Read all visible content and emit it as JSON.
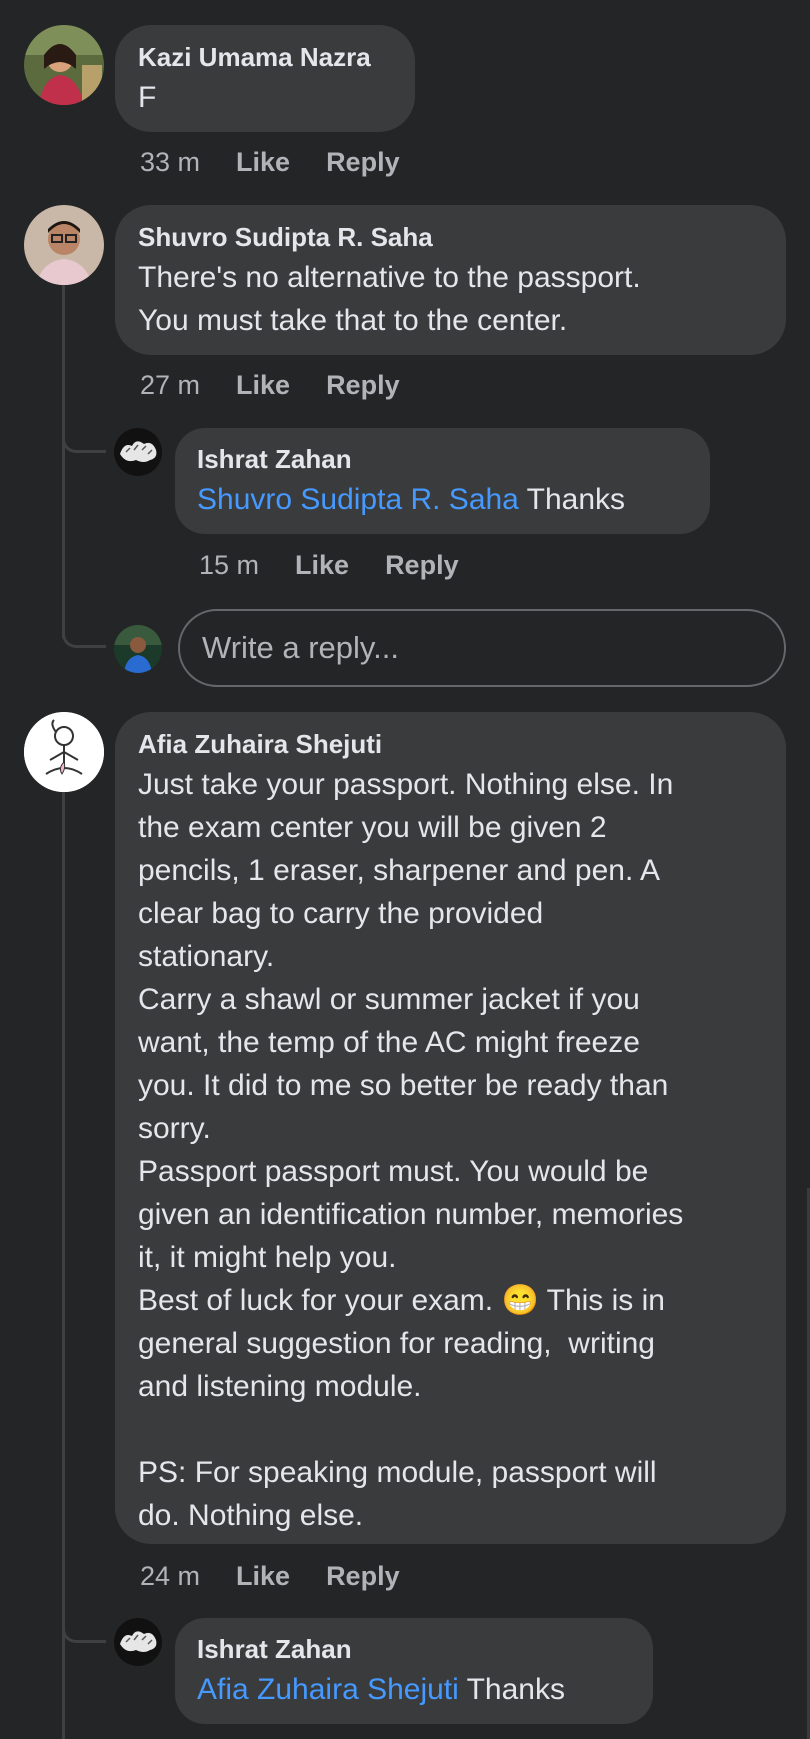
{
  "comments": [
    {
      "author": "Kazi Umama Nazra",
      "text": "F",
      "time": "33 m",
      "like": "Like",
      "reply": "Reply",
      "avatar": "profile-photo-woman"
    },
    {
      "author": "Shuvro Sudipta R. Saha",
      "text": "There's no alternative to the passport.\nYou must take that to the center.",
      "time": "27 m",
      "like": "Like",
      "reply": "Reply",
      "avatar": "profile-photo-man-glasses",
      "replies": [
        {
          "author": "Ishrat Zahan",
          "mention": "Shuvro Sudipta R. Saha",
          "text": " Thanks",
          "time": "15 m",
          "like": "Like",
          "reply": "Reply",
          "avatar": "profile-photo-doodle"
        }
      ],
      "reply_box": {
        "placeholder": "Write a reply...",
        "avatar": "profile-photo-current-user"
      }
    },
    {
      "author": "Afia Zuhaira Shejuti",
      "text": "Just take your passport. Nothing else. In\nthe exam center you will be given 2\npencils, 1 eraser, sharpener and pen. A\nclear bag to carry the provided\nstationary.\nCarry a shawl or summer jacket if you\nwant, the temp of the AC might freeze\nyou. It did to me so better be ready than\nsorry.\nPassport passport must. You would be\ngiven an identification number, memories\nit, it might help you.\nBest of luck for your exam. 😁 This is in\ngeneral suggestion for reading,  writing\nand listening module.\n\nPS: For speaking module, passport will\ndo. Nothing else.",
      "time": "24 m",
      "like": "Like",
      "reply": "Reply",
      "avatar": "profile-photo-meditating-doodle",
      "replies": [
        {
          "author": "Ishrat Zahan",
          "mention": "Afia Zuhaira Shejuti",
          "text": " Thanks",
          "avatar": "profile-photo-doodle"
        }
      ]
    }
  ],
  "colors": {
    "background": "#242526",
    "bubble": "#3a3b3c",
    "mention": "#4599ff",
    "meta": "#b0b3b8"
  }
}
